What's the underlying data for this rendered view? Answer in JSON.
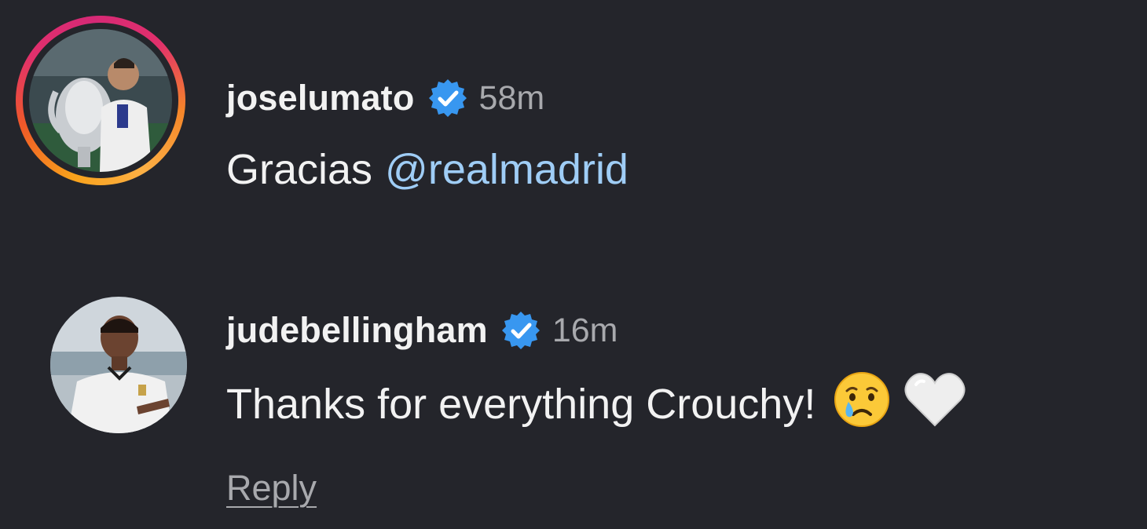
{
  "comments": [
    {
      "username": "joselumato",
      "verified": true,
      "time": "58m",
      "text": "Gracias",
      "mention": "@realmadrid",
      "avatar_has_story_ring": true
    },
    {
      "username": "judebellingham",
      "verified": true,
      "time": "16m",
      "text": "Thanks for everything Crouchy!",
      "emojis": [
        "crying-face-emoji",
        "white-heart-emoji"
      ],
      "reply_label": "Reply"
    }
  ],
  "colors": {
    "background": "#24252b",
    "text": "#f2f2f2",
    "secondary_text": "#a8a9ad",
    "mention": "#9fcdf6",
    "verified_badge": "#3897f0"
  }
}
